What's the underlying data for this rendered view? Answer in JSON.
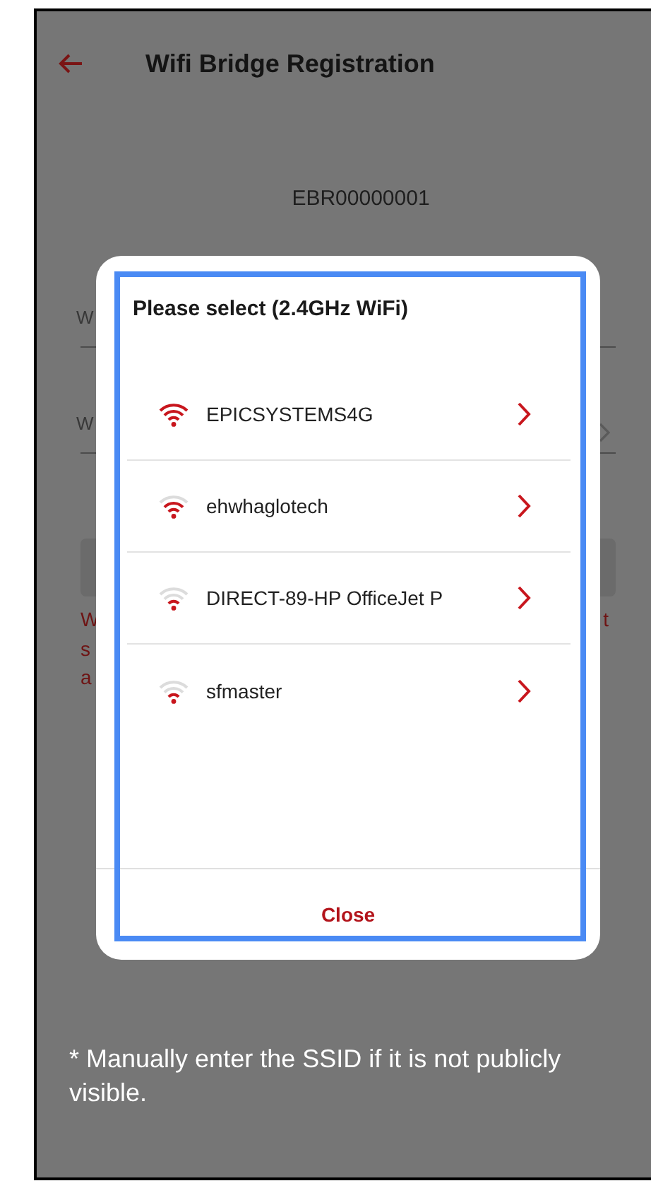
{
  "header": {
    "title": "Wifi Bridge Registration"
  },
  "device_id": "EBR00000001",
  "background_fields": [
    {
      "label": "W",
      "chevron": false
    },
    {
      "label": "W",
      "chevron": true
    }
  ],
  "background_warning": {
    "lines": [
      {
        "left": "W",
        "right": "t"
      },
      {
        "left": "s"
      },
      {
        "left": "a"
      }
    ]
  },
  "dialog": {
    "title": "Please select (2.4GHz WiFi)",
    "networks": [
      {
        "ssid": "EPICSYSTEMS4G",
        "kind": "strong"
      },
      {
        "ssid": "ehwhaglotech",
        "kind": "medium"
      },
      {
        "ssid": "DIRECT-89-HP OfficeJet P",
        "kind": "weak"
      },
      {
        "ssid": "sfmaster",
        "kind": "weak"
      }
    ],
    "close_label": "Close"
  },
  "footnote": "* Manually enter the SSID if it is not publicly visible."
}
